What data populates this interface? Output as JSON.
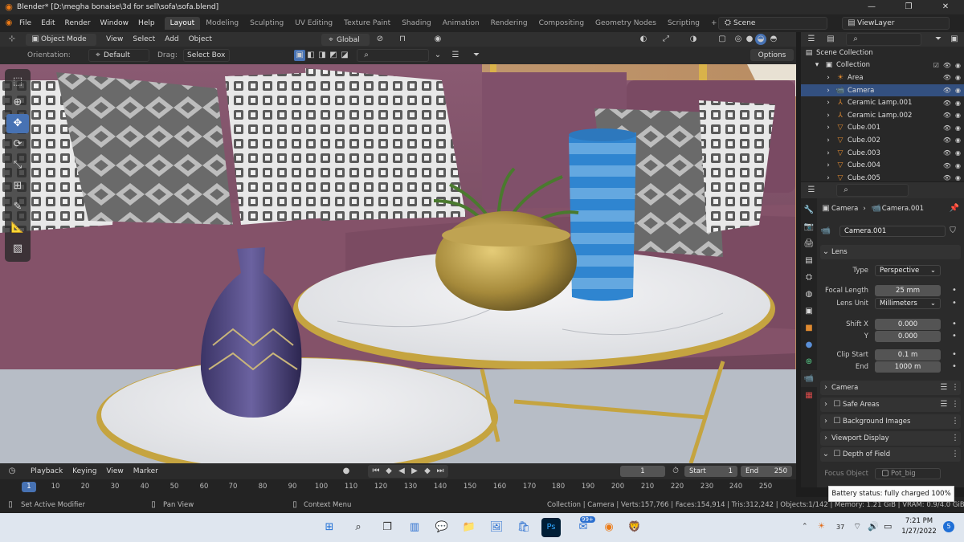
{
  "window": {
    "title": "Blender* [D:\\megha bonaise\\3d for sell\\sofa\\sofa.blend]"
  },
  "menu": [
    "File",
    "Edit",
    "Render",
    "Window",
    "Help"
  ],
  "workspaces": [
    "Layout",
    "Modeling",
    "Sculpting",
    "UV Editing",
    "Texture Paint",
    "Shading",
    "Animation",
    "Rendering",
    "Compositing",
    "Geometry Nodes",
    "Scripting"
  ],
  "active_workspace": "Layout",
  "scene": "Scene",
  "view_layer": "ViewLayer",
  "viewport_header": {
    "mode": "Object Mode",
    "menus": [
      "View",
      "Select",
      "Add",
      "Object"
    ],
    "transform": "Global"
  },
  "tool_settings": {
    "orientation_label": "Orientation:",
    "orientation": "Default",
    "drag_label": "Drag:",
    "drag": "Select Box",
    "options": "Options"
  },
  "outliner": {
    "root": "Scene Collection",
    "collection": "Collection",
    "items": [
      {
        "name": "Area",
        "icon": "light-icon",
        "selected": false
      },
      {
        "name": "Camera",
        "icon": "camera-icon",
        "selected": true
      },
      {
        "name": "Ceramic Lamp.001",
        "icon": "armature-icon",
        "selected": false
      },
      {
        "name": "Ceramic Lamp.002",
        "icon": "armature-icon",
        "selected": false
      },
      {
        "name": "Cube.001",
        "icon": "mesh-icon",
        "selected": false
      },
      {
        "name": "Cube.002",
        "icon": "mesh-icon",
        "selected": false
      },
      {
        "name": "Cube.003",
        "icon": "mesh-icon",
        "selected": false
      },
      {
        "name": "Cube.004",
        "icon": "mesh-icon",
        "selected": false
      },
      {
        "name": "Cube.005",
        "icon": "mesh-icon",
        "selected": false
      }
    ]
  },
  "properties": {
    "breadcrumb": [
      "Camera",
      "Camera.001"
    ],
    "data_name": "Camera.001",
    "lens_section": "Lens",
    "type_label": "Type",
    "type_value": "Perspective",
    "focal_length_label": "Focal Length",
    "focal_length_value": "25 mm",
    "lens_unit_label": "Lens Unit",
    "lens_unit_value": "Millimeters",
    "shift_x_label": "Shift X",
    "shift_x_value": "0.000",
    "shift_y_label": "Y",
    "shift_y_value": "0.000",
    "clip_start_label": "Clip Start",
    "clip_start_value": "0.1 m",
    "clip_end_label": "End",
    "clip_end_value": "1000 m",
    "sections": [
      "Camera",
      "Safe Areas",
      "Background Images",
      "Viewport Display",
      "Depth of Field"
    ],
    "focus_object_label": "Focus Object",
    "focus_object_value": "Pot_big"
  },
  "timeline": {
    "menus": [
      "Playback",
      "Keying",
      "View",
      "Marker"
    ],
    "current_frame": "1",
    "start_label": "Start",
    "start_value": "1",
    "end_label": "End",
    "end_value": "250",
    "ticks": [
      "1",
      "10",
      "20",
      "30",
      "40",
      "50",
      "60",
      "70",
      "80",
      "90",
      "100",
      "110",
      "120",
      "130",
      "140",
      "150",
      "160",
      "170",
      "180",
      "190",
      "200",
      "210",
      "220",
      "230",
      "240",
      "250"
    ]
  },
  "statusbar": {
    "left": "Set Active Modifier",
    "middle": "Pan View",
    "context": "Context Menu",
    "stats": "Collection | Camera | Verts:157,766 | Faces:154,914 | Tris:312,242 | Objects:1/142 | Memory: 1.21 GiB | VRAM: 0.9/4.0 GiB | 3.0.0"
  },
  "toast": "Battery status: fully charged 100%",
  "taskbar": {
    "time": "7:21 PM",
    "date": "1/27/2022",
    "badge": "99+",
    "temp": "37",
    "notif": "5"
  },
  "colors": {
    "accent": "#4772b3",
    "blender_orange": "#ec7a16",
    "selected_row": "#335080"
  }
}
